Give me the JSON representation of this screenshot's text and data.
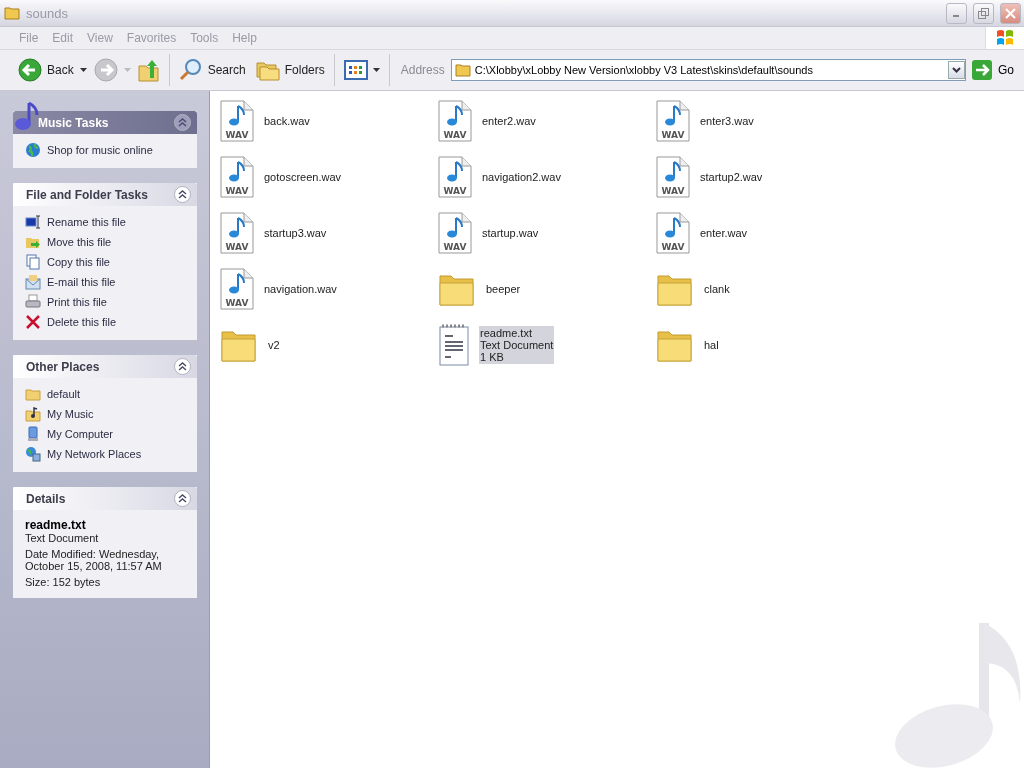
{
  "window": {
    "title": "sounds",
    "active": false
  },
  "menu": [
    "File",
    "Edit",
    "View",
    "Favorites",
    "Tools",
    "Help"
  ],
  "toolbar": {
    "back": "Back",
    "search": "Search",
    "folders": "Folders"
  },
  "address": {
    "label": "Address",
    "value": "C:\\Xlobby\\xLobby New Version\\xlobby V3 Latest\\skins\\default\\sounds",
    "go": "Go"
  },
  "sidebar": [
    {
      "kind": "music",
      "title": "Music Tasks",
      "expanded": true,
      "items": [
        {
          "label": "Shop for music online"
        }
      ]
    },
    {
      "kind": "tasks",
      "title": "File and Folder Tasks",
      "expanded": true,
      "items": [
        {
          "label": "Rename this file"
        },
        {
          "label": "Move this file"
        },
        {
          "label": "Copy this file"
        },
        {
          "label": "E-mail this file"
        },
        {
          "label": "Print this file"
        },
        {
          "label": "Delete this file"
        }
      ]
    },
    {
      "kind": "places",
      "title": "Other Places",
      "expanded": true,
      "items": [
        {
          "label": "default"
        },
        {
          "label": "My Music"
        },
        {
          "label": "My Computer"
        },
        {
          "label": "My Network Places"
        }
      ]
    },
    {
      "kind": "details",
      "title": "Details",
      "expanded": true,
      "name": "readme.txt",
      "type": "Text Document",
      "modified": "Date Modified: Wednesday, October 15, 2008, 11:57 AM",
      "size": "Size: 152 bytes"
    }
  ],
  "files": [
    {
      "kind": "wav",
      "name": "back.wav",
      "badge": "WAV",
      "selected": false
    },
    {
      "kind": "wav",
      "name": "enter2.wav",
      "badge": "WAV",
      "selected": false
    },
    {
      "kind": "wav",
      "name": "enter3.wav",
      "badge": "WAV",
      "selected": false
    },
    {
      "kind": "wav",
      "name": "gotoscreen.wav",
      "badge": "WAV",
      "selected": false
    },
    {
      "kind": "wav",
      "name": "navigation2.wav",
      "badge": "WAV",
      "selected": false
    },
    {
      "kind": "wav",
      "name": "startup2.wav",
      "badge": "WAV",
      "selected": false
    },
    {
      "kind": "wav",
      "name": "startup3.wav",
      "badge": "WAV",
      "selected": false
    },
    {
      "kind": "wav",
      "name": "startup.wav",
      "badge": "WAV",
      "selected": false
    },
    {
      "kind": "wav",
      "name": "enter.wav",
      "badge": "WAV",
      "selected": false
    },
    {
      "kind": "wav",
      "name": "navigation.wav",
      "badge": "WAV",
      "selected": false
    },
    {
      "kind": "folder",
      "name": "beeper",
      "selected": false
    },
    {
      "kind": "folder",
      "name": "clank",
      "selected": false
    },
    {
      "kind": "folder",
      "name": "v2",
      "selected": false
    },
    {
      "kind": "text",
      "name": "readme.txt",
      "type": "Text Document",
      "size": "1 KB",
      "selected": true
    },
    {
      "kind": "folder",
      "name": "hal",
      "selected": false
    }
  ]
}
